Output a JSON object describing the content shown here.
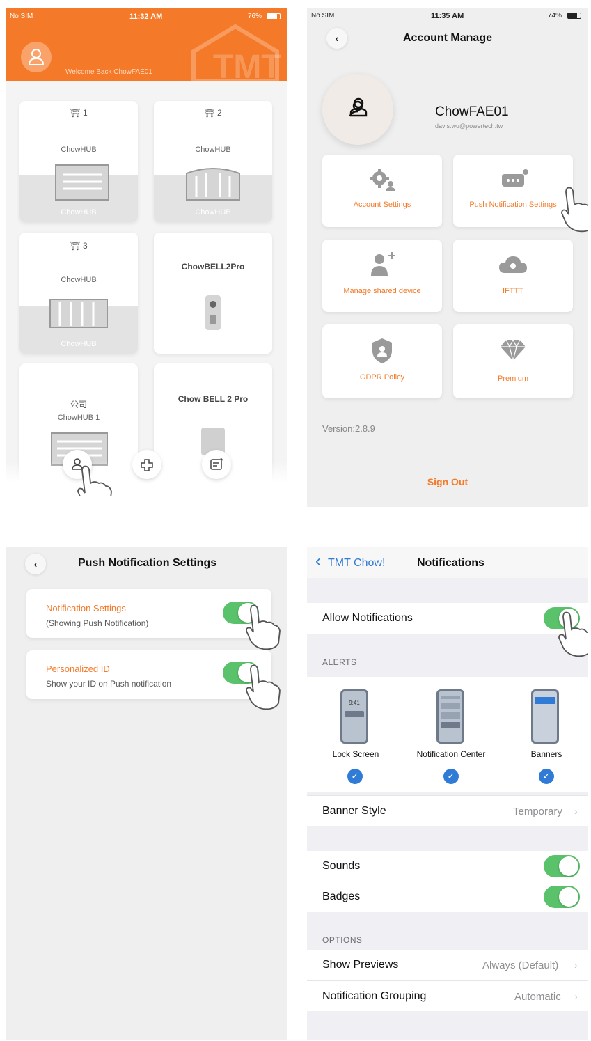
{
  "panel1": {
    "status": {
      "carrier": "No SIM",
      "time": "11:32 AM",
      "battery": "76%"
    },
    "welcome": "Welcome Back ChowFAE01",
    "devices": [
      {
        "num": "1",
        "name": "ChowHUB",
        "tag": "ChowHUB"
      },
      {
        "num": "2",
        "name": "ChowHUB",
        "tag": "ChowHUB"
      },
      {
        "num": "3",
        "name": "ChowHUB",
        "tag": "ChowHUB"
      },
      {
        "title": "ChowBELL2Pro"
      },
      {
        "num": "公司",
        "name": "ChowHUB 1"
      },
      {
        "title": "Chow BELL 2 Pro"
      }
    ],
    "icons": {
      "user": "user-icon",
      "add": "add-icon",
      "notes": "notes-icon"
    }
  },
  "panel2": {
    "status": {
      "carrier": "No SIM",
      "time": "11:35 AM",
      "battery": "74%"
    },
    "title": "Account Manage",
    "username": "ChowFAE01",
    "email": "davis.wu@powertech.tw",
    "tiles": [
      {
        "label": "Account Settings",
        "icon": "gear-user-icon"
      },
      {
        "label": "Push Notification Settings",
        "icon": "chat-bubble-icon"
      },
      {
        "label": "Manage shared device",
        "icon": "add-user-icon"
      },
      {
        "label": "IFTTT",
        "icon": "cloud-icon"
      },
      {
        "label": "GDPR Policy",
        "icon": "shield-icon"
      },
      {
        "label": "Premium",
        "icon": "diamond-icon"
      }
    ],
    "version": "Version:2.8.9",
    "sign_out": "Sign Out"
  },
  "panel3": {
    "title": "Push Notification Settings",
    "rows": [
      {
        "title": "Notification Settings",
        "subtitle": "(Showing Push Notification)",
        "on": true
      },
      {
        "title": "Personalized ID",
        "subtitle": "Show your ID on Push notification",
        "on": true
      }
    ]
  },
  "panel4": {
    "back": "TMT Chow!",
    "title": "Notifications",
    "allow": "Allow Notifications",
    "alerts_header": "ALERTS",
    "alert_types": [
      {
        "label": "Lock Screen",
        "time": "9:41"
      },
      {
        "label": "Notification Center"
      },
      {
        "label": "Banners"
      }
    ],
    "banner_style": {
      "label": "Banner Style",
      "value": "Temporary"
    },
    "sounds": "Sounds",
    "badges": "Badges",
    "options_header": "OPTIONS",
    "show_previews": {
      "label": "Show Previews",
      "value": "Always (Default)"
    },
    "grouping": {
      "label": "Notification Grouping",
      "value": "Automatic"
    }
  },
  "colors": {
    "accent": "#f47a2a",
    "toggle": "#5ac26a",
    "ios_blue": "#2f7bd6",
    "grey_bg": "#efefef"
  }
}
